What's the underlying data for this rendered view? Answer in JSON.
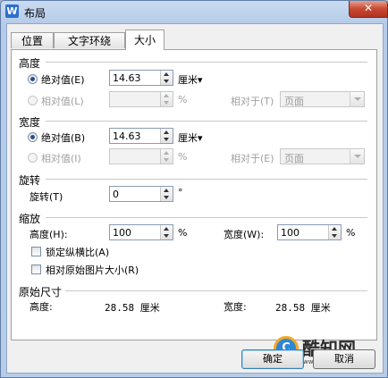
{
  "window": {
    "title": "布局",
    "app_icon": "W",
    "close_glyph": "✕"
  },
  "tabs": [
    {
      "label": "位置",
      "active": false
    },
    {
      "label": "文字环绕",
      "active": false
    },
    {
      "label": "大小",
      "active": true
    }
  ],
  "height": {
    "group": "高度",
    "absolute_label": "绝对值(E)",
    "absolute_value": "14.63",
    "absolute_unit": "厘米▾",
    "relative_label": "相对值(L)",
    "relative_value": "",
    "relative_unit": "%",
    "relative_to_label": "相对于(T)",
    "relative_to_value": "页面"
  },
  "width": {
    "group": "宽度",
    "absolute_label": "绝对值(B)",
    "absolute_value": "14.63",
    "absolute_unit": "厘米▾",
    "relative_label": "相对值(I)",
    "relative_value": "",
    "relative_unit": "%",
    "relative_to_label": "相对于(E)",
    "relative_to_value": "页面"
  },
  "rotate": {
    "group": "旋转",
    "label": "旋转(T)",
    "value": "0",
    "unit": "°"
  },
  "scale": {
    "group": "缩放",
    "height_label": "高度(H):",
    "height_value": "100",
    "height_unit": "%",
    "width_label": "宽度(W):",
    "width_value": "100",
    "width_unit": "%",
    "lock_ratio_label": "锁定纵横比(A)",
    "relative_original_label": "相对原始图片大小(R)"
  },
  "original": {
    "group": "原始尺寸",
    "height_label": "高度:",
    "height_value": "28.58 厘米",
    "width_label": "宽度:",
    "width_value": "28.58 厘米"
  },
  "buttons": {
    "ok": "确定",
    "cancel": "取消"
  },
  "watermark": {
    "circle_text": "C",
    "brand": "酷知网",
    "url": "www.coozhi.com"
  }
}
